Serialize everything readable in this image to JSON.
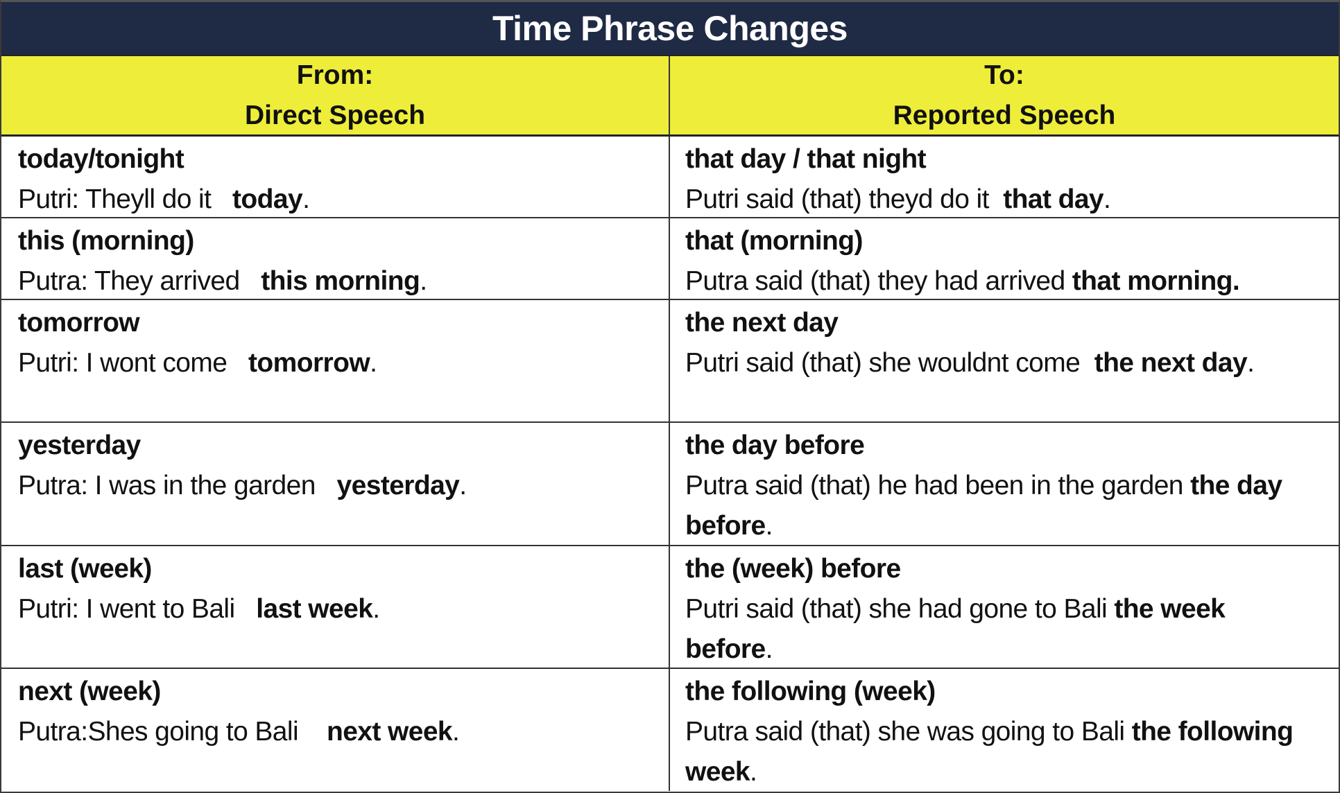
{
  "title": "Time Phrase Changes",
  "colors": {
    "title_bg": "#1f2a44",
    "header_bg": "#eeee3a",
    "title_text": "#ffffff",
    "border": "#333333"
  },
  "header": {
    "from_line1": "From:",
    "from_line2": "Direct Speech",
    "to_line1": "To:",
    "to_line2": "Reported Speech"
  },
  "rows": [
    {
      "from": {
        "phrase": "today/tonight",
        "example_plain": "Putri: Theyll do it   ",
        "example_bold": "today",
        "example_end": "."
      },
      "to": {
        "phrase": "that day / that night",
        "example_plain": "Putri said (that) theyd do it  ",
        "example_bold": "that day",
        "example_end": "."
      }
    },
    {
      "from": {
        "phrase": "this (morning)",
        "example_plain": "Putra: They arrived   ",
        "example_bold": "this morning",
        "example_end": "."
      },
      "to": {
        "phrase": "that (morning)",
        "example_plain": "Putra said (that) they had arrived ",
        "example_bold": "that morning.",
        "example_end": ""
      }
    },
    {
      "from": {
        "phrase": "tomorrow",
        "example_plain": "Putri: I wont come   ",
        "example_bold": "tomorrow",
        "example_end": "."
      },
      "to": {
        "phrase": "the next day",
        "example_plain": "Putri said (that) she wouldnt come  ",
        "example_bold": "the next day",
        "example_end": "."
      }
    },
    {
      "from": {
        "phrase": "yesterday",
        "example_plain": "Putra: I was in the garden   ",
        "example_bold": "yesterday",
        "example_end": "."
      },
      "to": {
        "phrase": "the day before",
        "example_plain": "Putra said (that) he had been in the garden ",
        "example_bold": "the day before",
        "example_end": "."
      }
    },
    {
      "from": {
        "phrase": "last (week)",
        "example_plain": "Putri: I went to Bali   ",
        "example_bold": "last week",
        "example_end": "."
      },
      "to": {
        "phrase": "the (week) before",
        "example_plain": "Putri said (that) she had gone to Bali ",
        "example_bold": "the week before",
        "example_end": "."
      }
    },
    {
      "from": {
        "phrase": "next (week)",
        "example_plain": "Putra:Shes going to Bali    ",
        "example_bold": "next week",
        "example_end": "."
      },
      "to": {
        "phrase": "the following (week)",
        "example_plain": "Putra said (that) she was going to Bali ",
        "example_bold": "the following week",
        "example_end": "."
      }
    }
  ]
}
